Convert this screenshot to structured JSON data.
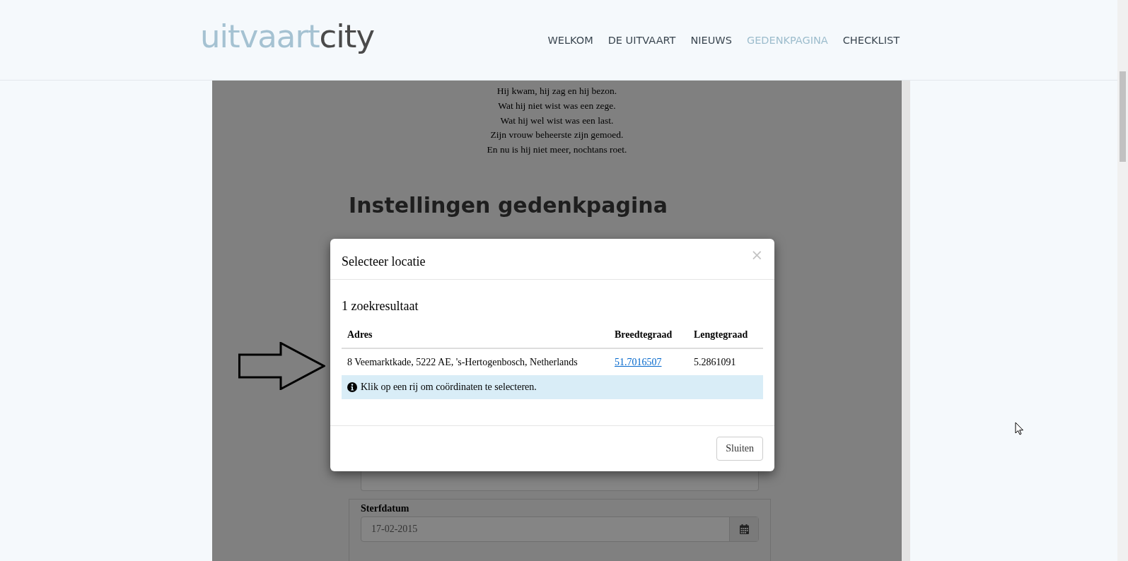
{
  "header": {
    "logo": {
      "part_1": "uitvaart",
      "part_2": "city"
    },
    "nav": [
      {
        "label": "WELKOM",
        "selected": false
      },
      {
        "label": "DE UITVAART",
        "selected": false
      },
      {
        "label": "NIEUWS",
        "selected": false
      },
      {
        "label": "GEDENKPAGINA",
        "selected": true
      },
      {
        "label": "CHECKLIST",
        "selected": false
      }
    ]
  },
  "poem": [
    "Hij kwam, hij zag en hij bezon.",
    "Wat hij niet wist was een zege.",
    "Wat hij wel wist was een last.",
    "Zijn vrouw beheerste zijn gemoed.",
    "En nu is hij niet meer, nochtans roet."
  ],
  "heading": "Instellingen gedenkpagina",
  "form": {
    "fields": [
      {
        "label": "Sterfdatum",
        "value": "17-02-2015"
      }
    ]
  },
  "modal": {
    "title": "Selecteer locatie",
    "close": "×",
    "result_count": "1 zoekresultaat",
    "table": {
      "columns": [
        "Adres",
        "Breedtegraad",
        "Lengtegraad"
      ],
      "rows": [
        [
          "8 Veemarktkade, 5222 AE, 's-Hertogenbosch, Netherlands",
          "51.7016507",
          "5.2861091"
        ]
      ]
    },
    "info": "Klik op een rij om coördinaten te selecteren.",
    "buttons": [
      "Sluiten"
    ]
  }
}
